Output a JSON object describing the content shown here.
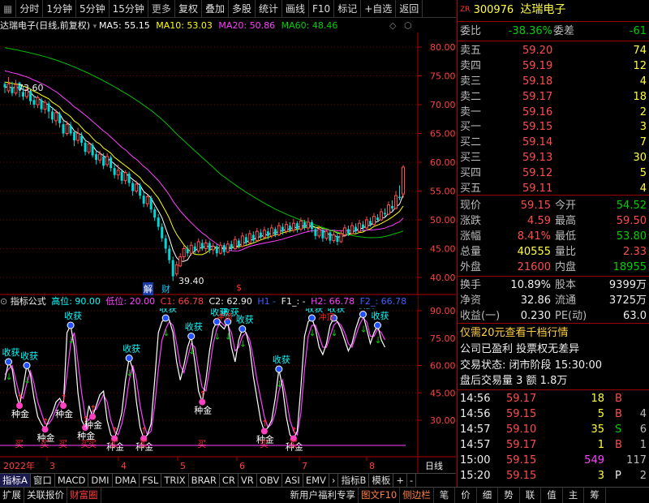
{
  "toolbar": {
    "items": [
      "分时",
      "1分钟",
      "5分钟",
      "15分钟",
      "更多",
      "复权",
      "叠加",
      "多股",
      "统计",
      "画线",
      "F10",
      "标记",
      "+自选",
      "返回"
    ]
  },
  "main_info": {
    "title": "达瑞电子(日线,前复权)",
    "ma5": "MA5: 55.15",
    "ma10": "MA10: 53.03",
    "ma20": "MA20: 50.86",
    "ma60": "MA60: 48.46"
  },
  "price_labels": {
    "high": "73.60",
    "low": "39.40"
  },
  "markers": {
    "jie": "解",
    "cai": "财",
    "dollar": "$"
  },
  "indicator_info": {
    "name": "指标公式",
    "high": "高位: 90.00",
    "low": "低位: 20.00",
    "c1": "C1: 66.78",
    "c2": "C2: 62.90",
    "h1": "H1 -",
    "f1": "F1_: -",
    "h2": "H2: 66.78",
    "f2": "F2_: 66.78"
  },
  "indicator_labels": {
    "shouhuo": "收获",
    "zhongjin": "种金",
    "mai": "买",
    "chongding": "冲顶"
  },
  "date_axis": {
    "year": "2022年",
    "months": [
      "3",
      "4",
      "5",
      "6",
      "7",
      "8"
    ],
    "period": "日线"
  },
  "tabs": [
    "指标A",
    "窗口",
    "MACD",
    "DMI",
    "DMA",
    "FSL",
    "TRIX",
    "BRAR",
    "CR",
    "VR",
    "OBV",
    "ASI",
    "EMV"
  ],
  "tabs_right": [
    "指标B",
    "模板",
    "+",
    "-"
  ],
  "bottom_bar": {
    "left": [
      "扩展",
      "关联报价",
      "财富圈"
    ],
    "mid": [
      "新用户福利专享",
      "图文F10",
      "侧边栏"
    ],
    "right": [
      "笔",
      "价",
      "细",
      "势",
      "联",
      "值",
      "主",
      "筹"
    ]
  },
  "quote": {
    "code": "300976",
    "name": "达瑞电子",
    "weibi_label": "委比",
    "weibi": "-38.36%",
    "weicha_label": "委差",
    "weicha": "-61",
    "asks": [
      {
        "label": "卖五",
        "price": "59.20",
        "vol": "74"
      },
      {
        "label": "卖四",
        "price": "59.19",
        "vol": "12"
      },
      {
        "label": "卖三",
        "price": "59.18",
        "vol": "4"
      },
      {
        "label": "卖二",
        "price": "59.17",
        "vol": "18"
      },
      {
        "label": "卖一",
        "price": "59.16",
        "vol": "2"
      }
    ],
    "bids": [
      {
        "label": "买一",
        "price": "59.15",
        "vol": "3"
      },
      {
        "label": "买二",
        "price": "59.14",
        "vol": "7"
      },
      {
        "label": "买三",
        "price": "59.13",
        "vol": "30"
      },
      {
        "label": "买四",
        "price": "59.12",
        "vol": "5"
      },
      {
        "label": "买五",
        "price": "59.11",
        "vol": "4"
      }
    ],
    "stats": [
      {
        "l1": "现价",
        "v1": "59.15",
        "l2": "今开",
        "v2": "54.52"
      },
      {
        "l1": "涨跌",
        "v1": "4.59",
        "l2": "最高",
        "v2": "59.50"
      },
      {
        "l1": "涨幅",
        "v1": "8.41%",
        "l2": "最低",
        "v2": "53.80"
      },
      {
        "l1": "总量",
        "v1": "40555",
        "l2": "量比",
        "v2": "2.33"
      },
      {
        "l1": "外盘",
        "v1": "21600",
        "l2": "内盘",
        "v2": "18955"
      }
    ],
    "stats2": [
      {
        "l1": "换手",
        "v1": "10.89%",
        "l2": "股本",
        "v2": "9399万"
      },
      {
        "l1": "净资",
        "v1": "32.86",
        "l2": "流通",
        "v2": "3725万"
      },
      {
        "l1": "收益(一)",
        "v1": "0.230",
        "l2": "PE(动)",
        "v2": "63.0"
      }
    ],
    "promo1": "仅需20元查看千档行情",
    "promo2": "公司已盈利 投票权无差异",
    "status": "交易状态: 闭市阶段 15:30:00",
    "after": "盘后交易量 3 额 1.8万",
    "ticks": [
      {
        "t": "14:56",
        "p": "59.17",
        "v": "18",
        "d": "B",
        "x": ""
      },
      {
        "t": "14:56",
        "p": "59.15",
        "v": "5",
        "d": "B",
        "x": "4"
      },
      {
        "t": "14:57",
        "p": "59.10",
        "v": "35",
        "d": "S",
        "x": "6"
      },
      {
        "t": "14:57",
        "p": "59.17",
        "v": "1",
        "d": "B",
        "x": "1"
      },
      {
        "t": "15:00",
        "p": "59.15",
        "v": "549",
        "d": "",
        "x": "117"
      },
      {
        "t": "15:20",
        "p": "59.15",
        "v": "3",
        "d": "P",
        "x": "2"
      }
    ]
  },
  "colors": {
    "up": "#ff4d4d",
    "down": "#00d000",
    "ma5": "#ffffff",
    "ma10": "#ffff00",
    "ma20": "#ff40ff",
    "ma60": "#00c000"
  },
  "chart_data": {
    "type": "candlestick",
    "y_axis_main": [
      40.0,
      45.0,
      50.0,
      55.0,
      60.0,
      65.0,
      70.0,
      75.0,
      80.0
    ],
    "y_axis_indicator": [
      30.0,
      45.0,
      60.0,
      75.0,
      90.0
    ],
    "candles": [
      [
        73.6,
        73,
        74,
        72
      ],
      [
        72.4,
        73.6,
        74.8,
        72
      ],
      [
        73,
        72,
        74,
        71.5
      ],
      [
        72,
        73.5,
        74.3,
        71.6
      ],
      [
        73.8,
        72.5,
        74,
        71.3
      ],
      [
        72.2,
        71.4,
        73.2,
        70.8
      ],
      [
        71.4,
        72.6,
        73,
        71
      ],
      [
        72.4,
        70.6,
        72.8,
        70
      ],
      [
        70.8,
        70,
        71.6,
        69.4
      ],
      [
        70,
        71.2,
        71.6,
        69.4
      ],
      [
        70.8,
        69.2,
        71.2,
        68.6
      ],
      [
        69.2,
        70.4,
        70.8,
        68.4
      ],
      [
        70.2,
        68.8,
        70.6,
        67.6
      ],
      [
        68.8,
        67.4,
        69.6,
        66.8
      ],
      [
        67.2,
        68.6,
        69.2,
        66.4
      ],
      [
        68.4,
        66.8,
        68.8,
        66
      ],
      [
        66.6,
        65,
        67.2,
        64.4
      ],
      [
        65,
        66.6,
        67.2,
        64.6
      ],
      [
        66.4,
        65,
        67,
        64.6
      ],
      [
        65.2,
        63.8,
        65.6,
        62.8
      ],
      [
        63.8,
        65,
        66,
        63.2
      ],
      [
        64.6,
        63.4,
        65.2,
        62.8
      ],
      [
        63.4,
        61.8,
        64,
        61.2
      ],
      [
        61.8,
        63.2,
        63.6,
        61.4
      ],
      [
        63,
        61.2,
        63.4,
        60.8
      ],
      [
        61.4,
        60.4,
        62,
        59.6
      ],
      [
        60.4,
        61.4,
        62,
        59.8
      ],
      [
        61,
        59.4,
        61.6,
        58.8
      ],
      [
        59.6,
        61,
        61.6,
        59.2
      ],
      [
        60.8,
        59,
        61.2,
        58.4
      ],
      [
        59,
        57.8,
        59.6,
        57.2
      ],
      [
        57.8,
        58.6,
        59.6,
        57
      ],
      [
        58.4,
        56.8,
        58.8,
        56.2
      ],
      [
        56.8,
        58.2,
        58.6,
        56.2
      ],
      [
        58,
        56.4,
        58.4,
        55.8
      ],
      [
        56.4,
        55,
        56.8,
        54.2
      ],
      [
        55,
        56.2,
        56.8,
        54.6
      ],
      [
        56,
        54.2,
        56.4,
        53.6
      ],
      [
        54.2,
        52.8,
        54.8,
        52.2
      ],
      [
        52.8,
        54,
        54.4,
        52.2
      ],
      [
        53.8,
        51.8,
        54.2,
        51.2
      ],
      [
        51.8,
        50.4,
        52.2,
        49.8
      ],
      [
        50.4,
        48.8,
        51,
        48.2
      ],
      [
        48.8,
        46.8,
        49.4,
        46.2
      ],
      [
        46.8,
        45,
        47.4,
        44.2
      ],
      [
        45,
        43,
        45.6,
        42.4
      ],
      [
        43,
        40.2,
        43.6,
        39.4
      ],
      [
        40.6,
        42.2,
        42.8,
        40.2
      ],
      [
        42,
        43.6,
        44.2,
        41.8
      ],
      [
        43.6,
        45,
        45.6,
        43
      ],
      [
        45,
        44.2,
        45.6,
        43.6
      ],
      [
        44.2,
        45.6,
        46.2,
        43.8
      ],
      [
        45.4,
        44.6,
        46,
        44
      ],
      [
        44.6,
        46.2,
        46.8,
        44.2
      ],
      [
        46,
        45,
        46.6,
        44.6
      ],
      [
        45,
        46,
        46.6,
        44.4
      ],
      [
        46,
        44.8,
        46.4,
        44.2
      ],
      [
        44.8,
        45.4,
        46,
        44
      ],
      [
        45.4,
        44.2,
        45.8,
        43.6
      ],
      [
        44.2,
        45.6,
        46.2,
        44
      ],
      [
        45.6,
        44.4,
        46,
        43.8
      ],
      [
        44.4,
        45.8,
        46.4,
        44.2
      ],
      [
        45.8,
        45,
        46.4,
        44.6
      ],
      [
        45,
        46.6,
        47.2,
        44.8
      ],
      [
        46.4,
        45.4,
        46.8,
        45
      ],
      [
        45.4,
        47.2,
        47.8,
        45.2
      ],
      [
        47,
        46,
        47.6,
        45.6
      ],
      [
        46,
        47.6,
        48.2,
        45.8
      ],
      [
        47.4,
        46.4,
        48,
        46
      ],
      [
        46.4,
        48,
        48.6,
        46.2
      ],
      [
        47.8,
        47,
        48.4,
        46.6
      ],
      [
        47,
        48.2,
        48.8,
        46.8
      ],
      [
        48,
        47.2,
        48.6,
        46.6
      ],
      [
        47.2,
        48.6,
        49.2,
        46.8
      ],
      [
        48.4,
        47.4,
        48.8,
        47
      ],
      [
        47.4,
        49,
        49.6,
        47.2
      ],
      [
        48.8,
        48,
        49.4,
        47.4
      ],
      [
        48,
        49.2,
        49.8,
        47.6
      ],
      [
        49,
        48.2,
        49.6,
        47.8
      ],
      [
        48.2,
        49.4,
        50.2,
        47.8
      ],
      [
        49.4,
        48.4,
        49.8,
        47.8
      ],
      [
        48.4,
        49.8,
        50.4,
        48
      ],
      [
        49.6,
        48.6,
        50,
        48.2
      ],
      [
        48.6,
        49.6,
        50.4,
        48
      ],
      [
        49.6,
        48.4,
        50,
        47.8
      ],
      [
        48.4,
        47.2,
        48.8,
        46.6
      ],
      [
        47.2,
        48.4,
        49,
        46.8
      ],
      [
        48.2,
        46.8,
        48.6,
        46.2
      ],
      [
        46.8,
        48,
        48.4,
        46.4
      ],
      [
        47.8,
        46.4,
        48.2,
        45.8
      ],
      [
        46.4,
        47.4,
        48,
        46
      ],
      [
        47.2,
        46.2,
        47.8,
        45.6
      ],
      [
        46.2,
        47.6,
        48.2,
        46
      ],
      [
        47.4,
        48.6,
        49.2,
        47
      ],
      [
        48.4,
        47.6,
        49,
        47.2
      ],
      [
        47.6,
        49,
        49.6,
        47.4
      ],
      [
        48.8,
        48,
        49.4,
        47.6
      ],
      [
        48,
        49.4,
        50,
        47.8
      ],
      [
        49.2,
        48.6,
        49.8,
        48
      ],
      [
        48.6,
        50,
        50.6,
        48.4
      ],
      [
        49.8,
        49.2,
        50.4,
        48.8
      ],
      [
        49.2,
        50.6,
        51.2,
        49
      ],
      [
        50.4,
        50,
        51,
        49.6
      ],
      [
        50,
        51.4,
        52,
        49.8
      ],
      [
        51.2,
        51,
        52,
        50.6
      ],
      [
        51,
        52.6,
        53.2,
        50.8
      ],
      [
        52.4,
        52,
        53.4,
        51.6
      ],
      [
        52,
        54.2,
        55,
        51.8
      ],
      [
        54,
        53.8,
        56,
        53.4
      ],
      [
        54.5,
        59.15,
        59.5,
        53.8
      ]
    ],
    "ind_series": [
      [
        52,
        55
      ],
      [
        62,
        58
      ],
      [
        58,
        60
      ],
      [
        45,
        52
      ],
      [
        38,
        44
      ],
      [
        48,
        42
      ],
      [
        60,
        50
      ],
      [
        55,
        57
      ],
      [
        42,
        50
      ],
      [
        32,
        40
      ],
      [
        28,
        34
      ],
      [
        25,
        28
      ],
      [
        30,
        28
      ],
      [
        34,
        31
      ],
      [
        40,
        36
      ],
      [
        42,
        40
      ],
      [
        38,
        40
      ],
      [
        78,
        55
      ],
      [
        82,
        72
      ],
      [
        70,
        78
      ],
      [
        45,
        62
      ],
      [
        30,
        45
      ],
      [
        26,
        32
      ],
      [
        38,
        30
      ],
      [
        32,
        35
      ],
      [
        38,
        36
      ],
      [
        44,
        40
      ],
      [
        46,
        44
      ],
      [
        30,
        40
      ],
      [
        22,
        30
      ],
      [
        20,
        24
      ],
      [
        26,
        22
      ],
      [
        34,
        28
      ],
      [
        52,
        38
      ],
      [
        64,
        52
      ],
      [
        58,
        60
      ],
      [
        40,
        52
      ],
      [
        26,
        38
      ],
      [
        20,
        28
      ],
      [
        22,
        22
      ],
      [
        28,
        24
      ],
      [
        52,
        38
      ],
      [
        78,
        58
      ],
      [
        84,
        74
      ],
      [
        86,
        80
      ],
      [
        85,
        84
      ],
      [
        78,
        82
      ],
      [
        62,
        72
      ],
      [
        52,
        60
      ],
      [
        60,
        56
      ],
      [
        70,
        64
      ],
      [
        76,
        72
      ],
      [
        62,
        70
      ],
      [
        46,
        58
      ],
      [
        40,
        48
      ],
      [
        52,
        46
      ],
      [
        68,
        58
      ],
      [
        80,
        72
      ],
      [
        84,
        80
      ],
      [
        82,
        84
      ],
      [
        80,
        82
      ],
      [
        84,
        82
      ],
      [
        70,
        78
      ],
      [
        62,
        68
      ],
      [
        74,
        70
      ],
      [
        80,
        76
      ],
      [
        78,
        78
      ],
      [
        70,
        74
      ],
      [
        54,
        64
      ],
      [
        42,
        52
      ],
      [
        30,
        42
      ],
      [
        24,
        32
      ],
      [
        26,
        26
      ],
      [
        30,
        28
      ],
      [
        42,
        34
      ],
      [
        58,
        46
      ],
      [
        48,
        52
      ],
      [
        32,
        42
      ],
      [
        22,
        30
      ],
      [
        20,
        24
      ],
      [
        24,
        22
      ],
      [
        48,
        34
      ],
      [
        76,
        58
      ],
      [
        84,
        76
      ],
      [
        86,
        82
      ],
      [
        80,
        82
      ],
      [
        70,
        76
      ],
      [
        66,
        70
      ],
      [
        72,
        70
      ],
      [
        82,
        76
      ],
      [
        86,
        82
      ],
      [
        84,
        84
      ],
      [
        80,
        82
      ],
      [
        74,
        78
      ],
      [
        68,
        72
      ],
      [
        72,
        70
      ],
      [
        80,
        76
      ],
      [
        86,
        82
      ],
      [
        88,
        86
      ],
      [
        80,
        84
      ],
      [
        72,
        76
      ],
      [
        78,
        76
      ],
      [
        82,
        80
      ],
      [
        74,
        78
      ],
      [
        70,
        74
      ]
    ]
  }
}
